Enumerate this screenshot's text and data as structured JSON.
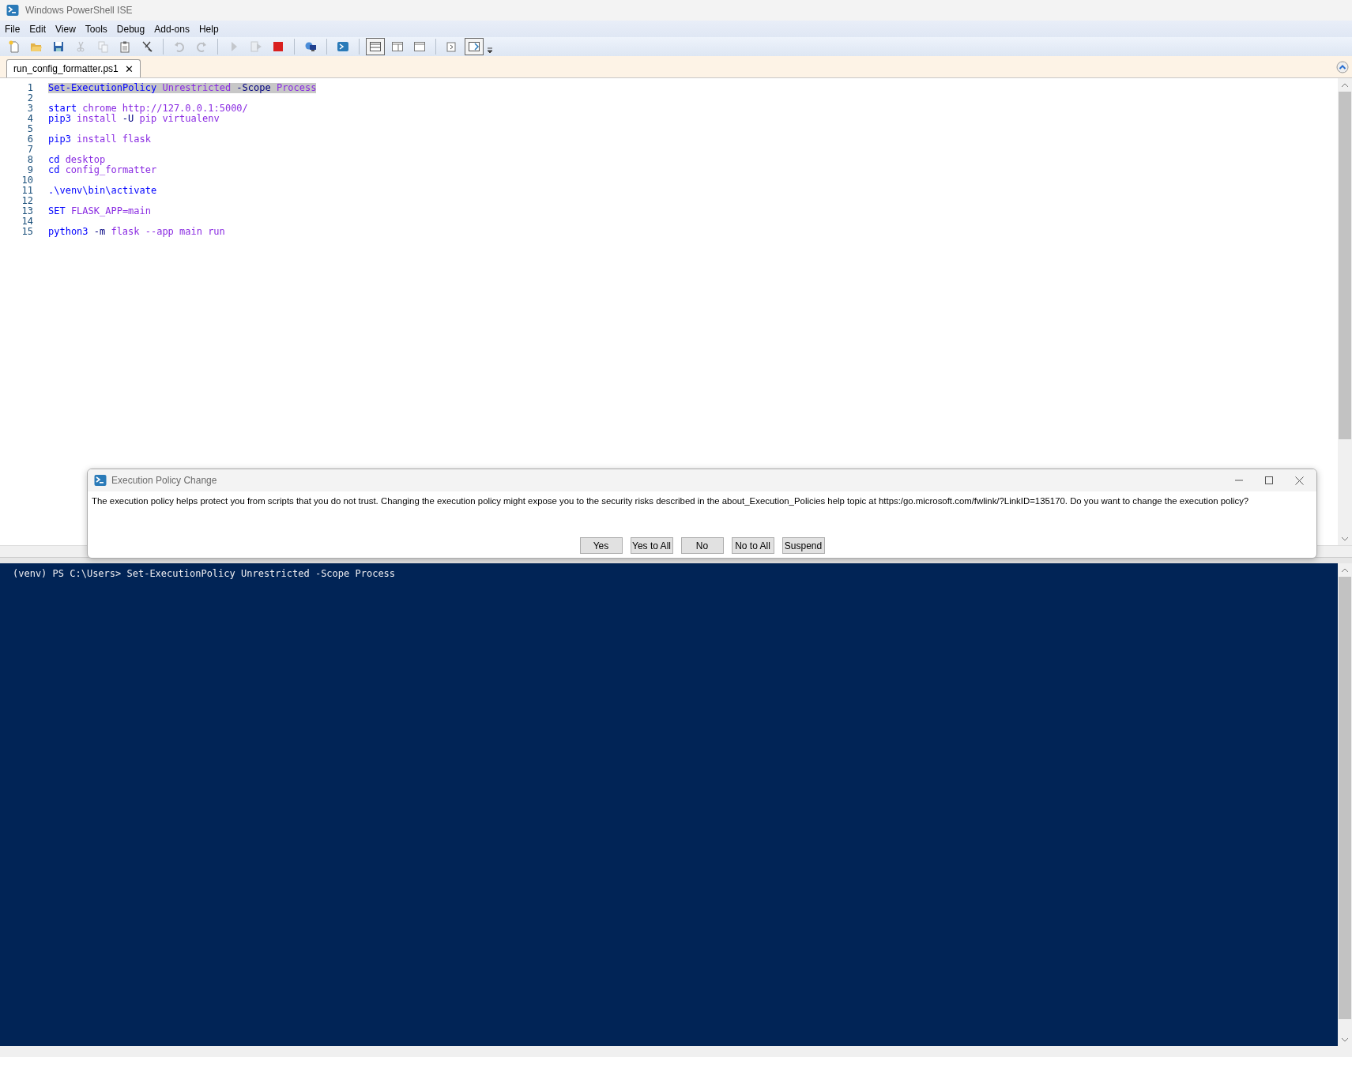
{
  "window": {
    "title": "Windows PowerShell ISE"
  },
  "menu": [
    "File",
    "Edit",
    "View",
    "Tools",
    "Debug",
    "Add-ons",
    "Help"
  ],
  "toolbar": [
    {
      "kind": "new",
      "disabled": false,
      "selected": false
    },
    {
      "kind": "open",
      "disabled": false,
      "selected": false
    },
    {
      "kind": "save",
      "disabled": false,
      "selected": false
    },
    {
      "kind": "cut",
      "disabled": true,
      "selected": false
    },
    {
      "kind": "copy",
      "disabled": true,
      "selected": false
    },
    {
      "kind": "paste",
      "disabled": false,
      "selected": false
    },
    {
      "kind": "clear",
      "disabled": false,
      "selected": false
    },
    {
      "kind": "separator"
    },
    {
      "kind": "undo",
      "disabled": true,
      "selected": false
    },
    {
      "kind": "redo",
      "disabled": true,
      "selected": false
    },
    {
      "kind": "separator"
    },
    {
      "kind": "run",
      "disabled": true,
      "selected": false
    },
    {
      "kind": "run-selection",
      "disabled": true,
      "selected": false
    },
    {
      "kind": "stop",
      "disabled": false,
      "selected": false
    },
    {
      "kind": "separator"
    },
    {
      "kind": "remote",
      "disabled": false,
      "selected": false
    },
    {
      "kind": "separator"
    },
    {
      "kind": "console",
      "disabled": false,
      "selected": false
    },
    {
      "kind": "separator"
    },
    {
      "kind": "pane-top",
      "disabled": false,
      "selected": true
    },
    {
      "kind": "pane-right",
      "disabled": false,
      "selected": false
    },
    {
      "kind": "pane-max",
      "disabled": false,
      "selected": false
    },
    {
      "kind": "separator"
    },
    {
      "kind": "commands",
      "disabled": false,
      "selected": false
    },
    {
      "kind": "addon",
      "disabled": false,
      "selected": true
    }
  ],
  "tabs": [
    {
      "label": "run_config_formatter.ps1",
      "close": "✕",
      "selected": true
    }
  ],
  "editor": {
    "lines": [
      {
        "number": "1",
        "selected": true,
        "tokens": [
          {
            "kind": "command",
            "text": "Set-ExecutionPolicy"
          },
          {
            "kind": "argument",
            "text": "Unrestricted"
          },
          {
            "kind": "parameter",
            "text": "-Scope"
          },
          {
            "kind": "argument",
            "text": "Process"
          }
        ]
      },
      {
        "number": "2"
      },
      {
        "number": "3",
        "selected": false,
        "tokens": [
          {
            "kind": "command",
            "text": "start"
          },
          {
            "kind": "argument",
            "text": "chrome"
          },
          {
            "kind": "argument",
            "text": "http://127.0.0.1:5000/"
          }
        ]
      },
      {
        "number": "4",
        "selected": false,
        "tokens": [
          {
            "kind": "command",
            "text": "pip3"
          },
          {
            "kind": "argument",
            "text": "install"
          },
          {
            "kind": "parameter",
            "text": "-U"
          },
          {
            "kind": "argument",
            "text": "pip"
          },
          {
            "kind": "argument",
            "text": "virtualenv"
          }
        ]
      },
      {
        "number": "5"
      },
      {
        "number": "6",
        "selected": false,
        "tokens": [
          {
            "kind": "command",
            "text": "pip3"
          },
          {
            "kind": "argument",
            "text": "install"
          },
          {
            "kind": "argument",
            "text": "flask"
          }
        ]
      },
      {
        "number": "7"
      },
      {
        "number": "8",
        "selected": false,
        "tokens": [
          {
            "kind": "command",
            "text": "cd"
          },
          {
            "kind": "argument",
            "text": "desktop"
          }
        ]
      },
      {
        "number": "9",
        "selected": false,
        "tokens": [
          {
            "kind": "command",
            "text": "cd"
          },
          {
            "kind": "argument",
            "text": "config_formatter"
          }
        ]
      },
      {
        "number": "10"
      },
      {
        "number": "11",
        "selected": false,
        "tokens": [
          {
            "kind": "command",
            "text": ".\\venv\\bin\\activate"
          }
        ]
      },
      {
        "number": "12"
      },
      {
        "number": "13",
        "selected": false,
        "tokens": [
          {
            "kind": "command",
            "text": "SET"
          },
          {
            "kind": "argument",
            "text": "FLASK_APP=main"
          }
        ]
      },
      {
        "number": "14"
      },
      {
        "number": "15",
        "selected": false,
        "tokens": [
          {
            "kind": "command",
            "text": "python3"
          },
          {
            "kind": "parameter",
            "text": "-m"
          },
          {
            "kind": "argument",
            "text": "flask"
          },
          {
            "kind": "argument",
            "text": "--app"
          },
          {
            "kind": "argument",
            "text": "main"
          },
          {
            "kind": "argument",
            "text": "run"
          }
        ]
      }
    ]
  },
  "dialog": {
    "title": "Execution Policy Change",
    "message": "The execution policy helps protect you from scripts that you do not trust. Changing the execution policy might expose you to the security risks described in the about_Execution_Policies help topic at https:/go.microsoft.com/fwlink/?LinkID=135170. Do you want to change the execution policy?",
    "buttons": [
      "Yes",
      "Yes to All",
      "No",
      "No to All",
      "Suspend"
    ]
  },
  "console": {
    "lines": [
      "(venv) PS C:\\Users> Set-ExecutionPolicy Unrestricted -Scope Process"
    ]
  }
}
